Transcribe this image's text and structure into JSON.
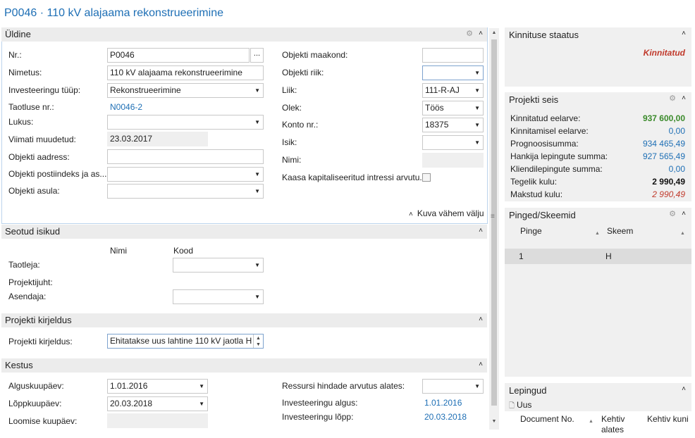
{
  "page_title": "P0046 · 110 kV alajaama rekonstrueerimine",
  "general": {
    "title": "Üldine",
    "left": [
      {
        "label": "Nr.:",
        "value": "P0046"
      },
      {
        "label": "Nimetus:",
        "value": "110 kV alajaama rekonstrueerimine"
      },
      {
        "label": "Investeeringu tüüp:",
        "value": "Rekonstrueerimine"
      },
      {
        "label": "Taotluse nr.:",
        "value": "N0046-2"
      },
      {
        "label": "Lukus:",
        "value": ""
      },
      {
        "label": "Viimati muudetud:",
        "value": "23.03.2017"
      },
      {
        "label": "Objekti aadress:",
        "value": ""
      },
      {
        "label": "Objekti postiindeks ja as...",
        "value": ""
      },
      {
        "label": "Objekti asula:",
        "value": ""
      }
    ],
    "right": [
      {
        "label": "Objekti maakond:",
        "value": ""
      },
      {
        "label": "Objekti riik:",
        "value": ""
      },
      {
        "label": "Liik:",
        "value": "111-R-AJ"
      },
      {
        "label": "Olek:",
        "value": "Töös"
      },
      {
        "label": "Konto nr.:",
        "value": "18375"
      },
      {
        "label": "Isik:",
        "value": ""
      },
      {
        "label": "Nimi:",
        "value": ""
      },
      {
        "label": "Kaasa kapitaliseeritud intressi arvutu...",
        "value": ""
      }
    ],
    "show_less": "Kuva vähem välju"
  },
  "persons": {
    "title": "Seotud isikud",
    "col_name": "Nimi",
    "col_code": "Kood",
    "rows": [
      "Taotleja:",
      "Projektijuht:",
      "Asendaja:"
    ]
  },
  "description": {
    "title": "Projekti kirjeldus",
    "label": "Projekti kirjeldus:",
    "value": "Ehitatakse uus lahtine 110 kV jaotla H"
  },
  "duration": {
    "title": "Kestus",
    "left": [
      {
        "label": "Alguskuupäev:",
        "value": "1.01.2016"
      },
      {
        "label": "Lõppkuupäev:",
        "value": "20.03.2018"
      },
      {
        "label": "Loomise kuupäev:",
        "value": ""
      }
    ],
    "right": [
      {
        "label": "Ressursi hindade arvutus alates:",
        "value": ""
      },
      {
        "label": "Investeeringu algus:",
        "value": "1.01.2016"
      },
      {
        "label": "Investeeringu lõpp:",
        "value": "20.03.2018"
      }
    ]
  },
  "factbox_status": {
    "title": "Kinnituse staatus",
    "value": "Kinnitatud"
  },
  "factbox_project": {
    "title": "Projekti seis",
    "rows": [
      {
        "label": "Kinnitatud eelarve:",
        "value": "937 600,00"
      },
      {
        "label": "Kinnitamisel eelarve:",
        "value": "0,00"
      },
      {
        "label": "Prognoosisumma:",
        "value": "934 465,49"
      },
      {
        "label": "Hankija lepingute summa:",
        "value": "927 565,49"
      },
      {
        "label": "Kliendilepingute summa:",
        "value": "0,00"
      },
      {
        "label": "Tegelik kulu:",
        "value": "2 990,49"
      },
      {
        "label": "Makstud kulu:",
        "value": "2 990,49"
      }
    ]
  },
  "factbox_voltage": {
    "title": "Pinged/Skeemid",
    "col_voltage": "Pinge",
    "col_scheme": "Skeem",
    "rows": [
      {
        "voltage": "1",
        "scheme": "H"
      }
    ]
  },
  "factbox_contracts": {
    "title": "Lepingud",
    "new_label": "Uus",
    "col_doc": "Document No.",
    "col_from": "Kehtiv alates",
    "col_to": "Kehtiv kuni"
  },
  "colors": {
    "accent": "#1e6fb5",
    "green": "#3a8a2a",
    "red": "#c0392b"
  }
}
